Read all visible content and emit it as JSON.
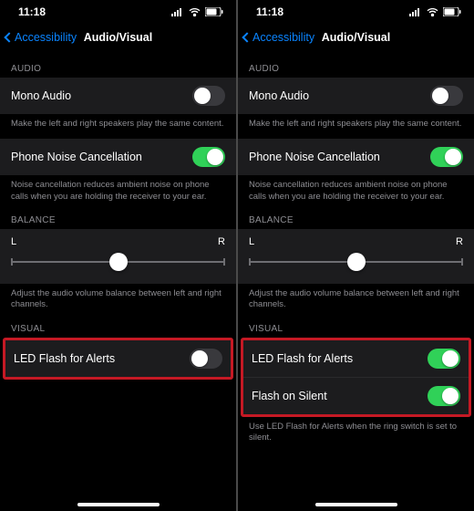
{
  "status": {
    "time": "11:18"
  },
  "nav": {
    "back": "Accessibility",
    "title": "Audio/Visual"
  },
  "sections": {
    "audio_header": "AUDIO",
    "mono_audio": {
      "label": "Mono Audio",
      "footer": "Make the left and right speakers play the same content."
    },
    "noise_cancel": {
      "label": "Phone Noise Cancellation",
      "footer": "Noise cancellation reduces ambient noise on phone calls when you are holding the receiver to your ear."
    },
    "balance_header": "BALANCE",
    "balance": {
      "left": "L",
      "right": "R",
      "footer": "Adjust the audio volume balance between left and right channels."
    },
    "visual_header": "VISUAL",
    "led_flash": {
      "label": "LED Flash for Alerts"
    },
    "flash_silent": {
      "label": "Flash on Silent",
      "footer": "Use LED Flash for Alerts when the ring switch is set to silent."
    }
  },
  "panes": {
    "left": {
      "mono_audio": false,
      "noise_cancel": true,
      "led_flash": false,
      "show_flash_silent": false
    },
    "right": {
      "mono_audio": false,
      "noise_cancel": true,
      "led_flash": true,
      "flash_silent": true,
      "show_flash_silent": true
    }
  }
}
